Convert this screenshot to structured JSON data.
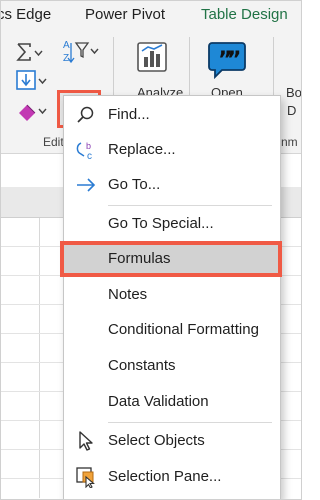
{
  "ribbon": {
    "tabs": [
      "cs Edge",
      "Power Pivot",
      "Table Design"
    ],
    "active_tab_color": "#217346",
    "group_label": "Edit",
    "analyze_label": "Analyze",
    "open_label": "Open",
    "partial_label_1": "Bo",
    "partial_label_2": "D",
    "partial_label_3": "nm",
    "icons": [
      "autosum-icon",
      "sort-filter-icon",
      "fill-icon",
      "find-select-icon",
      "clear-eraser-icon",
      "analyze-data-icon",
      "quote-bubble-icon"
    ]
  },
  "find_menu": {
    "items": [
      {
        "label": "Find...",
        "icon": "search-icon"
      },
      {
        "label": "Replace...",
        "icon": "replace-icon"
      },
      {
        "label": "Go To...",
        "icon": "arrow-right-icon"
      },
      {
        "label": "Go To Special...",
        "icon": ""
      },
      {
        "label": "Formulas",
        "icon": "",
        "highlighted": true
      },
      {
        "label": "Notes",
        "icon": ""
      },
      {
        "label": "Conditional Formatting",
        "icon": ""
      },
      {
        "label": "Constants",
        "icon": ""
      },
      {
        "label": "Data Validation",
        "icon": ""
      },
      {
        "label": "Select Objects",
        "icon": "cursor-arrow-icon"
      },
      {
        "label": "Selection Pane...",
        "icon": "selection-pane-icon"
      }
    ]
  },
  "colors": {
    "highlight_border": "#f05a45",
    "accent_blue": "#2b7cd3",
    "ribbon_bg": "#f3f3f3"
  }
}
